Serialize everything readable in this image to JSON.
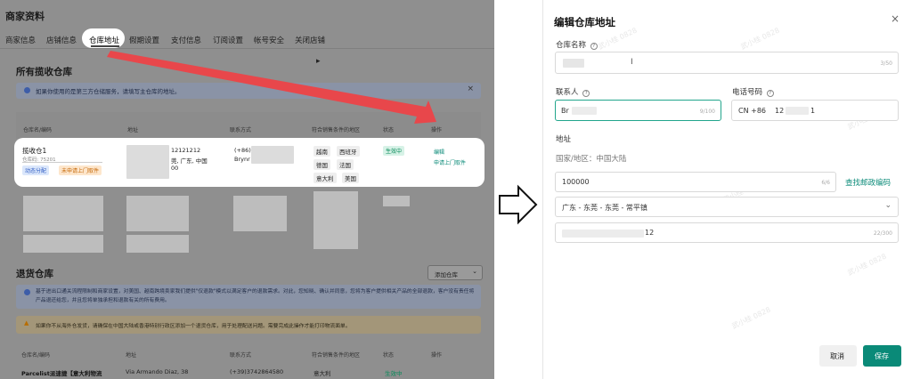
{
  "left": {
    "page_title": "商家资料",
    "tabs": [
      "商家信息",
      "店铺信息",
      "仓库地址",
      "假期设置",
      "支付信息",
      "订阅设置",
      "帐号安全",
      "关闭店铺"
    ],
    "active_tab_index": 2,
    "section1_title": "所有揽收仓库",
    "info_text": "如果你使用的是第三方仓储服务，请填写主仓库的地址。",
    "columns": [
      "仓库名/编码",
      "地址",
      "联系方式",
      "符合销售条件的地区",
      "状态",
      "操作"
    ],
    "row": {
      "name": "揽收仓1",
      "code": "仓库码: 75201",
      "tag1": "动态分配",
      "tag2": "未申请上门取件",
      "address_line1": "12121212",
      "address_line2": "莞, 广东, 中国",
      "address_line3": "00",
      "contact_line1": "(+86)",
      "contact_line2": "Brynr",
      "regions": [
        "越南",
        "西班牙",
        "德国",
        "法国",
        "意大利",
        "美国"
      ],
      "status": "生效中",
      "action1": "编辑",
      "action2": "申请上门取件"
    },
    "section2_title": "退货仓库",
    "add_button": "添加仓库",
    "notice1": "基于进出口通关流程限制和商家设置，对美国、越南跨境卖家我们提供\"仅退款\"模式以满足客户的退款需求。对此，您知晓、确认并同意，您将为客户提供相关产品的全部退款，客户没有责任将产品退还给您，并且您将单独承担和退款有关的所有费用。",
    "notice2": "如果你不从海外仓发货，请确保在中国大陆或香港特别行政区添加一个退货仓库，用于处理配送问题。需要完成此操作才能打印物流面单。",
    "columns2": [
      "仓库名/编码",
      "地址",
      "联系方式",
      "符合销售条件的地区",
      "状态",
      "操作"
    ],
    "row2": {
      "name": "Parcelist派速捷【意大利物流",
      "address": "Via Armando Diaz, 38",
      "contact": "(+39)3742864580",
      "region": "意大利",
      "status": "生效中"
    }
  },
  "dialog": {
    "title": "编辑仓库地址",
    "close_icon": "×",
    "warehouse_name_label": "仓库名称",
    "warehouse_name_count": "3/50",
    "contact_label": "联系人",
    "contact_value": "Br",
    "contact_count": "9/100",
    "phone_label": "电话号码",
    "phone_prefix": "CN +86",
    "phone_value": "12",
    "phone_suffix": "1",
    "address_label": "地址",
    "country_text": "国家/地区：中国大陆",
    "postcode_value": "100000",
    "postcode_count": "6/6",
    "find_postcode": "查找邮政编码",
    "region_value": "广东 - 东莞 - 东莞 - 常平镇",
    "detail_value": "12",
    "detail_count": "22/300",
    "cancel": "取消",
    "save": "保存",
    "watermark": "武小桂 0828"
  },
  "colors": {
    "accent": "#0a8a78",
    "arrow": "#e8474b",
    "dim_bg": "#8f8f8f"
  }
}
